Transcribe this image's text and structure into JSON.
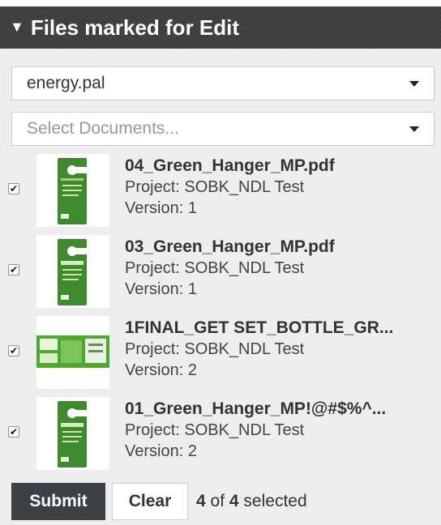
{
  "panel": {
    "title": "Files marked for Edit",
    "collapse_icon": "caret-down-icon"
  },
  "palette_select": {
    "value": "energy.pal"
  },
  "documents_select": {
    "placeholder": "Select Documents..."
  },
  "files": [
    {
      "name": "04_Green_Hanger_MP.pdf",
      "project": "Project: SOBK_NDL Test",
      "version": "Version: 1",
      "checked": true,
      "thumb": "hanger"
    },
    {
      "name": "03_Green_Hanger_MP.pdf",
      "project": "Project: SOBK_NDL Test",
      "version": "Version: 1",
      "checked": true,
      "thumb": "hanger"
    },
    {
      "name": "1FINAL_GET SET_BOTTLE_GR...",
      "project": "Project: SOBK_NDL Test",
      "version": "Version: 2",
      "checked": true,
      "thumb": "label"
    },
    {
      "name": "01_Green_Hanger_MP!@#$%^...",
      "project": "Project: SOBK_NDL Test",
      "version": "Version: 2",
      "checked": true,
      "thumb": "hanger"
    }
  ],
  "footer": {
    "submit_label": "Submit",
    "clear_label": "Clear",
    "selected_count": "4",
    "of_text": "of",
    "total_count": "4",
    "selected_text": "selected"
  },
  "colors": {
    "header_bg": "#3c3c3c",
    "panel_bg": "#eeeeee",
    "submit_bg": "#3b4046",
    "thumb_green": "#3f8a2c"
  }
}
